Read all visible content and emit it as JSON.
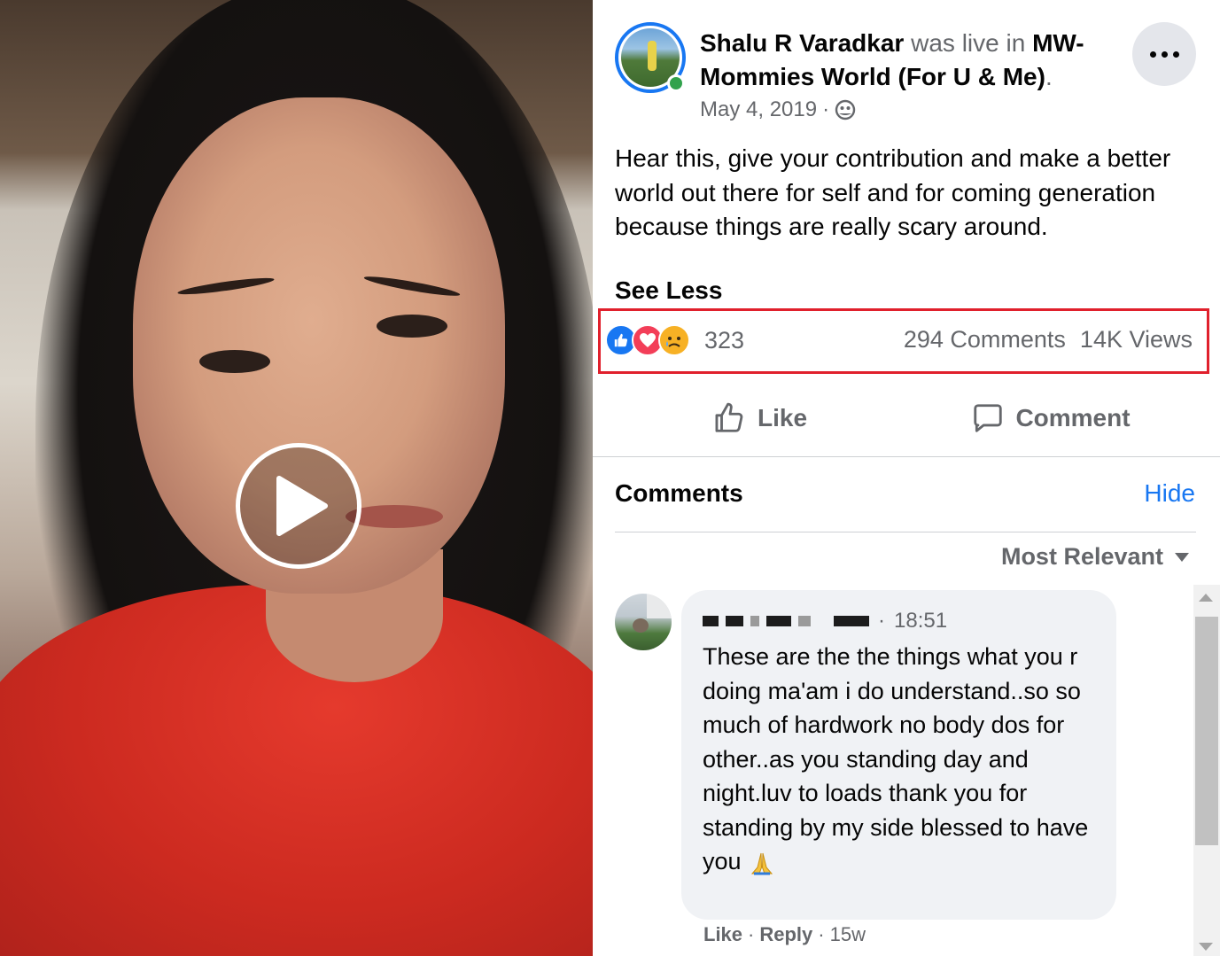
{
  "video": {
    "play_icon": "play-icon"
  },
  "post": {
    "author": "Shalu R Varadkar",
    "live_text": "was live in",
    "group": "MW-Mommies World (For U & Me)",
    "group_suffix": ".",
    "date": "May 4, 2019",
    "date_separator": "·",
    "privacy_icon": "public-group-icon",
    "more_icon": "more-options-icon",
    "body": "Hear this, give your contribution and make a better world out there for self and for coming generation because things are really scary around.",
    "see_less": "See Less"
  },
  "stats": {
    "reaction_icons": [
      "like-reaction-icon",
      "love-reaction-icon",
      "sad-reaction-icon"
    ],
    "reaction_count": "323",
    "comments": "294 Comments",
    "views": "14K Views",
    "highlight_color": "#e0202c"
  },
  "actions": {
    "like": "Like",
    "comment": "Comment"
  },
  "comments_section": {
    "title": "Comments",
    "hide": "Hide",
    "sort": "Most Relevant"
  },
  "comment": {
    "time": "18:51",
    "text": "These are the the things what you r doing ma'am i do understand..so so much of hardwork no body dos for other..as you standing day and night.luv to loads thank you for standing by my side blessed to have you",
    "like": "Like",
    "reply": "Reply",
    "age": "15w",
    "separator": "·"
  },
  "colors": {
    "accent": "#1877f2",
    "muted": "#65676b",
    "online": "#31a24c"
  }
}
